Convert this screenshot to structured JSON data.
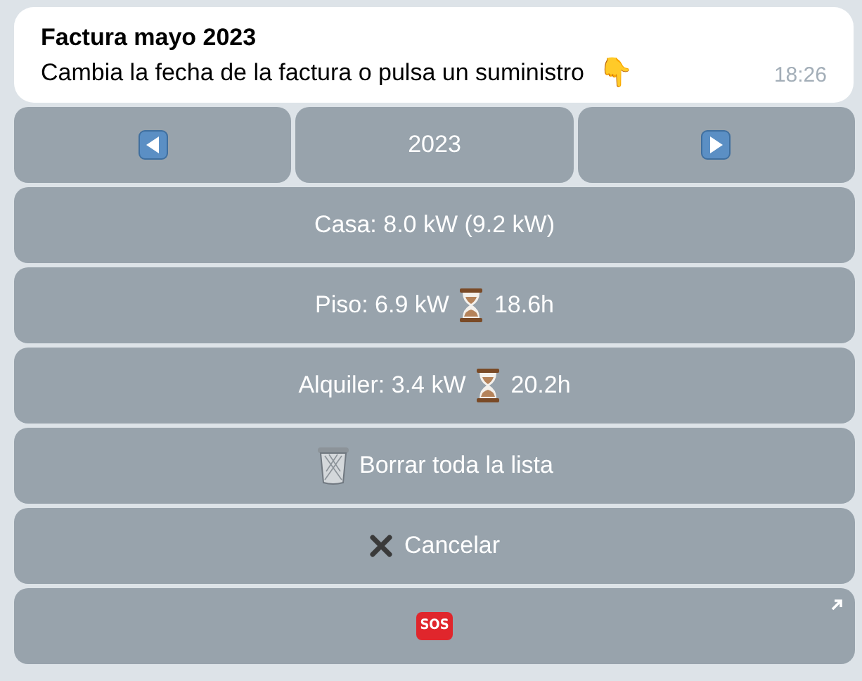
{
  "message": {
    "title": "Factura mayo 2023",
    "text": "Cambia la fecha de la factura o pulsa un suministro",
    "emoji": "👇",
    "time": "18:26"
  },
  "keyboard": [
    [
      {
        "kind": "previous"
      },
      {
        "kind": "text",
        "label": "2023"
      },
      {
        "kind": "next"
      }
    ],
    [
      {
        "kind": "text",
        "label": "Casa: 8.0 kW (9.2 kW)"
      }
    ],
    [
      {
        "kind": "timed",
        "label": "Piso: 6.9 kW",
        "suffix": "18.6h"
      }
    ],
    [
      {
        "kind": "timed",
        "label": "Alquiler: 3.4 kW",
        "suffix": "20.2h"
      }
    ],
    [
      {
        "kind": "clear",
        "label": "Borrar toda la lista"
      }
    ],
    [
      {
        "kind": "cancel",
        "label": "Cancelar"
      }
    ],
    [
      {
        "kind": "sign",
        "sign": "SOS",
        "link": true
      }
    ]
  ]
}
